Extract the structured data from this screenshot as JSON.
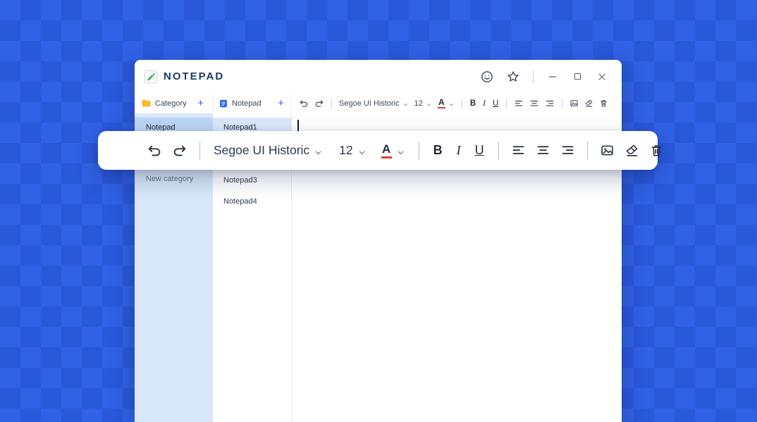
{
  "titlebar": {
    "title": "NOTEPAD"
  },
  "toolbar": {
    "category": {
      "label": "Category",
      "add": "+"
    },
    "notepad": {
      "label": "Notepad",
      "add": "+"
    },
    "font_name": "Segoe UI Historic",
    "font_size": "12",
    "color_button": "A",
    "bold": "B",
    "italic": "I",
    "underline": "U"
  },
  "sidebar": {
    "selected_item": "Notepad",
    "new_category": "New category"
  },
  "notes": {
    "items": [
      {
        "label": "Notepad1",
        "selected": true
      },
      {
        "label": "Notepad3",
        "selected": false
      },
      {
        "label": "Notepad4",
        "selected": false
      }
    ]
  },
  "overlay": {
    "font_name": "Segoe UI Historic",
    "font_size": "12",
    "color_button": "A",
    "bold": "B",
    "italic": "I",
    "underline": "U"
  },
  "colors": {
    "accent": "#2563eb",
    "background": "#2c5de4",
    "color_underline": "#e23b2e"
  }
}
